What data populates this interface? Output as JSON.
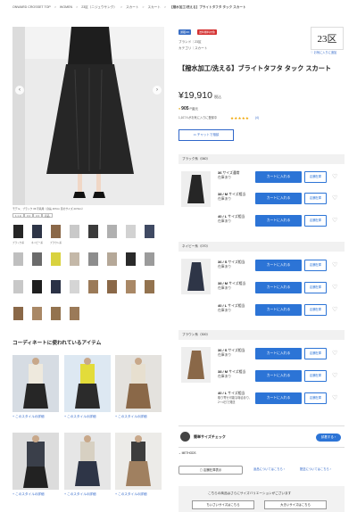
{
  "breadcrumb": [
    "ONWARD CROSSET TOP",
    ">",
    "WOMEN",
    ">",
    "23区（ニジュウサンク）",
    ">",
    "スカート",
    ">",
    "スカート",
    ">",
    "【撥水加工/洗える】ブライトタフタ タック スカート"
  ],
  "gallery": {
    "prev": "‹",
    "next": "›",
    "caption": "モデル：ブラック 36 号着用（身長 167cm 足のサイズ 23.5cm）",
    "chips": [
      "1:1 ※",
      "3:4",
      "4:3",
      "商品"
    ],
    "thumb_labels": [
      "ブラック系",
      "ネイビー系",
      "ブラウン系"
    ]
  },
  "coordinate": {
    "title": "コーディネートに使われているアイテム",
    "link": "このスタイルの詳細",
    "links": [
      "このスタイルの詳細",
      "このスタイルの詳細",
      "このスタイルの詳細",
      "このスタイルの詳細",
      "このスタイルの詳細",
      "このスタイルの詳細"
    ]
  },
  "product": {
    "badges": [
      "通販OK",
      "送料無料対象"
    ],
    "brand_label": "ブランド｜23区",
    "category_label": "カテゴリ｜スカート",
    "brand_logo": "23区",
    "brand_fav": "お気に入りに追加",
    "title": "【撥水加工/洗える】ブライトタフタ タック スカート",
    "price": "¥19,910",
    "tax": "税込",
    "points": "905",
    "points_suffix": "P還元",
    "fav_count": "1,107人がお気に入りに登録中",
    "stars": "★★★★★",
    "review_count": "(4)",
    "chat_button": "チャットで相談"
  },
  "colors": [
    {
      "header": "ブラック系（060）",
      "sizes": [
        {
          "size": "36",
          "unit": "サイズ",
          "note": "通常",
          "stock": "在庫あり"
        },
        {
          "size": "38 / M",
          "unit": "サイズ",
          "note": "相当",
          "stock": "在庫あり"
        },
        {
          "size": "40 / L",
          "unit": "サイズ",
          "note": "相当",
          "stock": "在庫あり"
        }
      ]
    },
    {
      "header": "ネイビー系（070）",
      "sizes": [
        {
          "size": "36 / S",
          "unit": "サイズ",
          "note": "相当",
          "stock": "在庫あり"
        },
        {
          "size": "38 / M",
          "unit": "サイズ",
          "note": "相当",
          "stock": "在庫あり"
        },
        {
          "size": "40 / L",
          "unit": "サイズ",
          "note": "相当",
          "stock": "在庫あり"
        }
      ]
    },
    {
      "header": "ブラウン系（300）",
      "sizes": [
        {
          "size": "36 / S",
          "unit": "サイズ",
          "note": "相当",
          "stock": "在庫あり"
        },
        {
          "size": "38 / M",
          "unit": "サイズ",
          "note": "相当",
          "stock": "在庫あり"
        },
        {
          "size": "40 / L",
          "unit": "サイズ",
          "note": "相当",
          "stock": "取り寄せ可能な場合あり、2〜4日で発送"
        }
      ]
    }
  ],
  "actions": {
    "cart": "カートに入れる",
    "store": "店舗在庫",
    "size_check": "簡単サイズチェック",
    "size_check_button": "試着する",
    "methods": "METHODS",
    "store_stock": "店舗在庫表示",
    "link_1": "返品についてはこちら",
    "link_2": "配送についてはこちら"
  },
  "variation": {
    "title": "こちらの商品はさらにサイズバリエーションがございます",
    "btn1": "ちいさいサイズはこちら",
    "btn2": "大きいサイズはこちら"
  },
  "colors_palette": {
    "accent": "#2c74d6",
    "link": "#2f66c9",
    "badge_red": "#d43131",
    "badge_blue": "#3a6fc4"
  }
}
